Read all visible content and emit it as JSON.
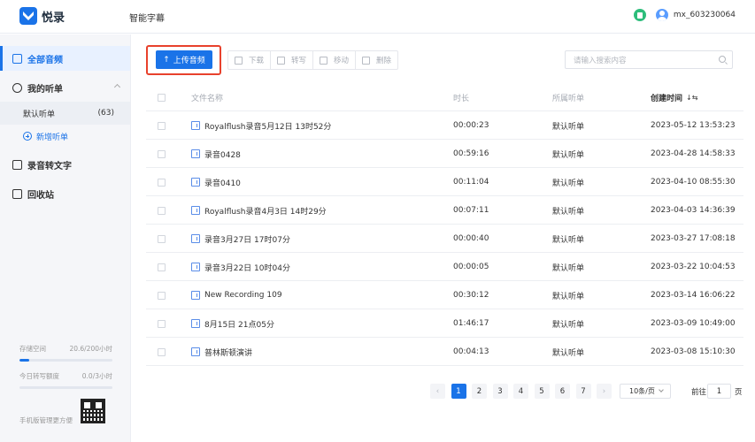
{
  "app": {
    "name": "悦录",
    "title": "智能字幕",
    "brand_color": "#1a73e8"
  },
  "user": {
    "name": "mx_603230064"
  },
  "sidebar": {
    "all_audio": "全部音频",
    "my_lists": "我的听单",
    "default_list": {
      "label": "默认听单",
      "count": "(63)"
    },
    "add_list": "新增听单",
    "transcribe": "录音转文字",
    "recycle": "回收站",
    "storage": {
      "label": "存储空间",
      "value": "20.6/200小时",
      "fraction": 0.103
    },
    "daily_quota": {
      "label": "今日转写额度",
      "value": "0.0/3小时",
      "fraction": 0.0
    },
    "mobile_manage": "手机版管理更方便"
  },
  "toolbar": {
    "upload": "上传音频",
    "download": "下载",
    "transcribe": "转写",
    "move": "移动",
    "delete": "删除",
    "search_placeholder": "请输入搜索内容"
  },
  "table": {
    "headers": {
      "name": "文件名称",
      "duration": "时长",
      "list": "所属听单",
      "created": "创建时间",
      "sort_glyph": "↓⇆"
    },
    "rows": [
      {
        "name": "Royalflush录音5月12日 13时52分",
        "duration": "00:00:23",
        "list": "默认听单",
        "created": "2023-05-12 13:53:23"
      },
      {
        "name": "录音0428",
        "duration": "00:59:16",
        "list": "默认听单",
        "created": "2023-04-28 14:58:33"
      },
      {
        "name": "录音0410",
        "duration": "00:11:04",
        "list": "默认听单",
        "created": "2023-04-10 08:55:30"
      },
      {
        "name": "Royalflush录音4月3日 14时29分",
        "duration": "00:07:11",
        "list": "默认听单",
        "created": "2023-04-03 14:36:39"
      },
      {
        "name": "录音3月27日 17时07分",
        "duration": "00:00:40",
        "list": "默认听单",
        "created": "2023-03-27 17:08:18"
      },
      {
        "name": "录音3月22日 10时04分",
        "duration": "00:00:05",
        "list": "默认听单",
        "created": "2023-03-22 10:04:53"
      },
      {
        "name": "New Recording 109",
        "duration": "00:30:12",
        "list": "默认听单",
        "created": "2023-03-14 16:06:22"
      },
      {
        "name": "8月15日 21点05分",
        "duration": "01:46:17",
        "list": "默认听单",
        "created": "2023-03-09 10:49:00"
      },
      {
        "name": "普林斯顿演讲",
        "duration": "00:04:13",
        "list": "默认听单",
        "created": "2023-03-08 15:10:30"
      }
    ]
  },
  "pagination": {
    "pages": [
      "1",
      "2",
      "3",
      "4",
      "5",
      "6",
      "7"
    ],
    "current": "1",
    "page_size": "10条/页",
    "goto_label": "前往",
    "goto_value": "1",
    "goto_unit": "页"
  }
}
